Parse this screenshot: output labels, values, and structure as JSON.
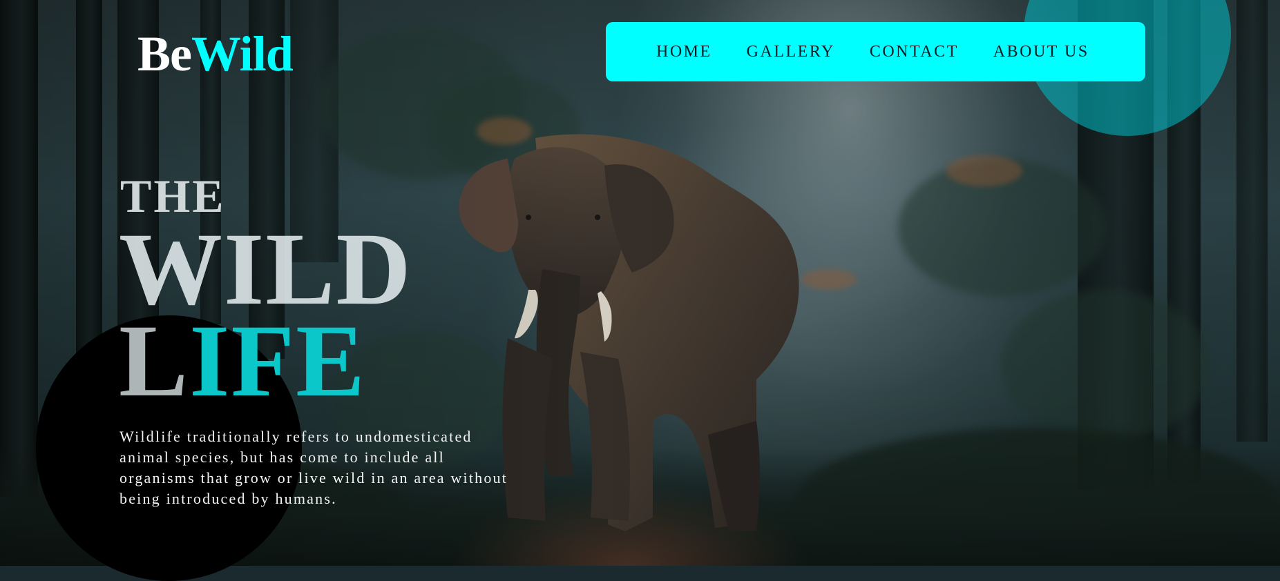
{
  "logo": {
    "part1": "Be",
    "part2": "Wild"
  },
  "nav": {
    "items": [
      "HOME",
      "GALLERY",
      "CONTACT",
      "ABOUT US"
    ]
  },
  "hero": {
    "line1": "THE",
    "line2": "WILD",
    "line3_first": "L",
    "line3_rest": "IFE",
    "description": "Wildlife traditionally refers to undomesticated animal species, but has come to include all organisms that grow or live wild in an area without being introduced by humans."
  },
  "colors": {
    "accent": "#00ffff",
    "accent_text": "#0cc7c9",
    "nav_text": "#0d1f24",
    "decor_circle_teal": "#00bec8",
    "decor_circle_dark": "#000000"
  },
  "icons": {
    "background": "forest-elephant-photo"
  }
}
